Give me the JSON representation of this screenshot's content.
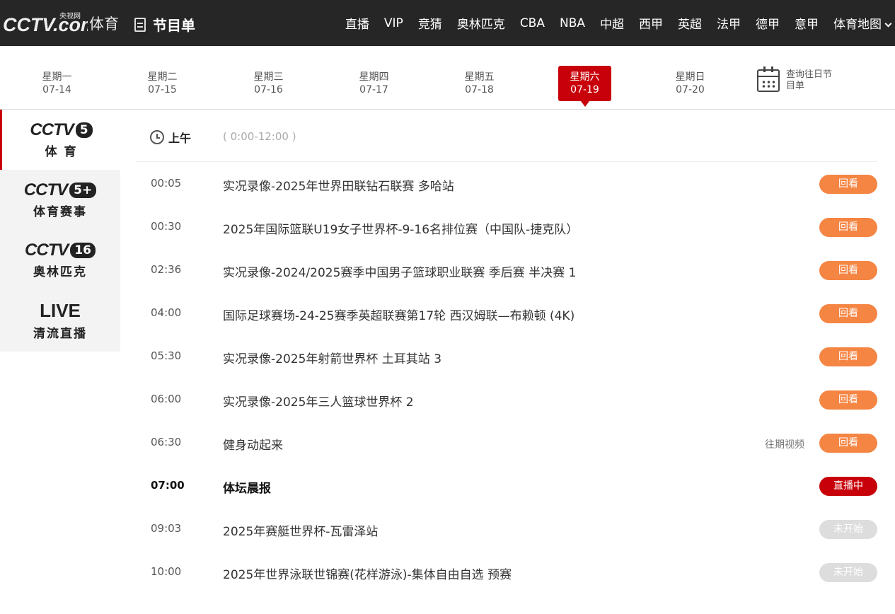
{
  "header": {
    "logo_text": "CCTV.com",
    "logo_small": "央视网",
    "logo_sport": "体育",
    "page_title": "节目单",
    "nav": [
      "直播",
      "VIP",
      "竞猜",
      "奥林匹克",
      "CBA",
      "NBA",
      "中超",
      "西甲",
      "英超",
      "法甲",
      "德甲",
      "意甲",
      "体育地图"
    ]
  },
  "week": {
    "days": [
      {
        "weekday": "星期一",
        "date": "07-14",
        "active": false
      },
      {
        "weekday": "星期二",
        "date": "07-15",
        "active": false
      },
      {
        "weekday": "星期三",
        "date": "07-16",
        "active": false
      },
      {
        "weekday": "星期四",
        "date": "07-17",
        "active": false
      },
      {
        "weekday": "星期五",
        "date": "07-18",
        "active": false
      },
      {
        "weekday": "星期六",
        "date": "07-19",
        "active": true
      },
      {
        "weekday": "星期日",
        "date": "07-20",
        "active": false
      }
    ],
    "history_label": "查询往日节目单"
  },
  "channels": [
    {
      "brand": "CCTV",
      "num": "5",
      "sub": "体 育",
      "active": true
    },
    {
      "brand": "CCTV",
      "num": "5+",
      "sub": "体育赛事",
      "active": false
    },
    {
      "brand": "CCTV",
      "num": "16",
      "sub": "奥林匹克",
      "active": false
    },
    {
      "brand": "LIVE",
      "num": "",
      "sub": "清流直播",
      "active": false
    }
  ],
  "schedule": {
    "period_label": "上午",
    "period_range": "( 0:00-12:00 )",
    "items": [
      {
        "time": "00:05",
        "title": "实况录像-2025年世界田联钻石联赛  多哈站",
        "status": "replay",
        "button": "回看",
        "extra": ""
      },
      {
        "time": "00:30",
        "title": "2025年国际篮联U19女子世界杯-9-16名排位赛（中国队-捷克队）",
        "status": "replay",
        "button": "回看",
        "extra": ""
      },
      {
        "time": "02:36",
        "title": "实况录像-2024/2025赛季中国男子篮球职业联赛 季后赛  半决赛 1",
        "status": "replay",
        "button": "回看",
        "extra": ""
      },
      {
        "time": "04:00",
        "title": "国际足球赛场-24-25赛季英超联赛第17轮 西汉姆联—布赖顿 (4K)",
        "status": "replay",
        "button": "回看",
        "extra": ""
      },
      {
        "time": "05:30",
        "title": "实况录像-2025年射箭世界杯 土耳其站 3",
        "status": "replay",
        "button": "回看",
        "extra": ""
      },
      {
        "time": "06:00",
        "title": "实况录像-2025年三人篮球世界杯 2",
        "status": "replay",
        "button": "回看",
        "extra": ""
      },
      {
        "time": "06:30",
        "title": "健身动起来",
        "status": "replay",
        "button": "回看",
        "extra": "往期视频"
      },
      {
        "time": "07:00",
        "title": "体坛晨报",
        "status": "live",
        "button": "直播中",
        "extra": ""
      },
      {
        "time": "09:03",
        "title": "2025年赛艇世界杯-瓦雷泽站",
        "status": "pending",
        "button": "未开始",
        "extra": ""
      },
      {
        "time": "10:00",
        "title": "2025年世界泳联世锦赛(花样游泳)-集体自由自选 预赛",
        "status": "pending",
        "button": "未开始",
        "extra": ""
      }
    ]
  },
  "colors": {
    "accent": "#c8000a",
    "replay": "#f58543",
    "pending": "#dddddd",
    "topbar": "#262626"
  }
}
